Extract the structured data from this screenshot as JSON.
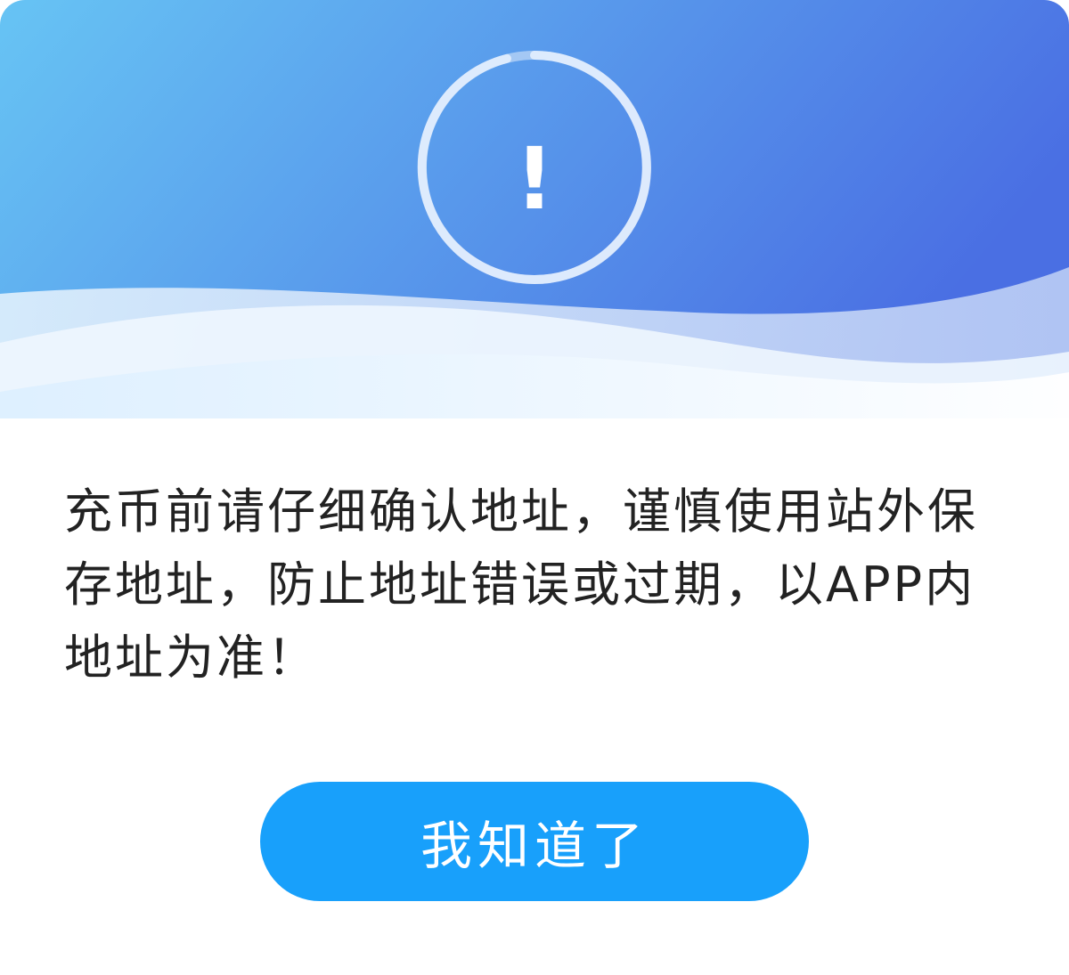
{
  "dialog": {
    "icon": "exclamation-icon",
    "icon_glyph": "!",
    "message": "充币前请仔细确认地址，谨慎使用站外保存地址，防止地址错误或过期，以APP内地址为准！",
    "confirm_label": "我知道了"
  },
  "colors": {
    "header_gradient_start": "#67c4f4",
    "header_gradient_end": "#4a6fe3",
    "button": "#18a0fb",
    "text": "#222222"
  }
}
